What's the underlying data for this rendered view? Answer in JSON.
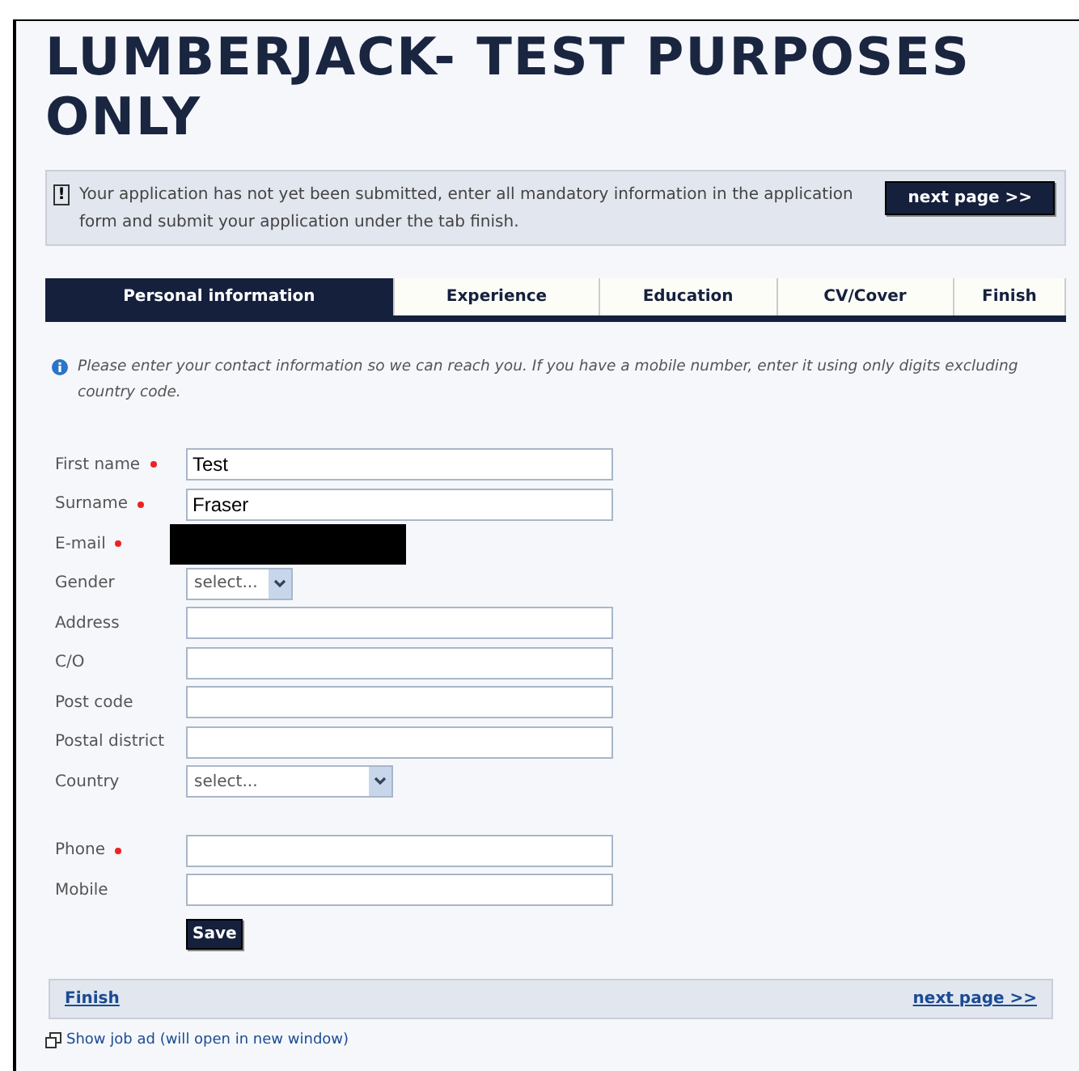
{
  "title": "LUMBERJACK- TEST PURPOSES ONLY",
  "notice": {
    "icon": "!",
    "text": "Your application has not yet been submitted, enter all mandatory information in the application form and submit your application under the tab finish.",
    "button": "next page >>"
  },
  "tabs": [
    {
      "label": "Personal information",
      "selected": true
    },
    {
      "label": "Experience",
      "selected": false
    },
    {
      "label": "Education",
      "selected": false
    },
    {
      "label": "CV/Cover",
      "selected": false
    },
    {
      "label": "Finish",
      "selected": false
    }
  ],
  "info": "Please enter your contact information so we can reach you. If you have a mobile number, enter it using only digits excluding country code.",
  "fields": [
    {
      "label": "First name",
      "required": true,
      "kind": "text",
      "value": "Test"
    },
    {
      "label": "Surname",
      "required": true,
      "kind": "text",
      "value": "Fraser"
    },
    {
      "label": "E-mail",
      "required": true,
      "kind": "redacted"
    },
    {
      "label": "Gender",
      "required": false,
      "kind": "select",
      "value": "select..."
    },
    {
      "label": "Address",
      "required": false,
      "kind": "text"
    },
    {
      "label": "C/O",
      "required": false,
      "kind": "text"
    },
    {
      "label": "Post code",
      "required": false,
      "kind": "text"
    },
    {
      "label": "Postal district",
      "required": false,
      "kind": "text"
    },
    {
      "label": "Country",
      "required": false,
      "kind": "wideselect",
      "value": "select..."
    }
  ],
  "contact_fields": [
    {
      "label": "Phone",
      "required": true,
      "kind": "text"
    },
    {
      "label": "Mobile",
      "required": false,
      "kind": "text"
    }
  ],
  "save": "Save",
  "footer": {
    "left": "Finish",
    "right": "next page >>"
  },
  "job_ad_link": "Show job ad (will open in new window)"
}
